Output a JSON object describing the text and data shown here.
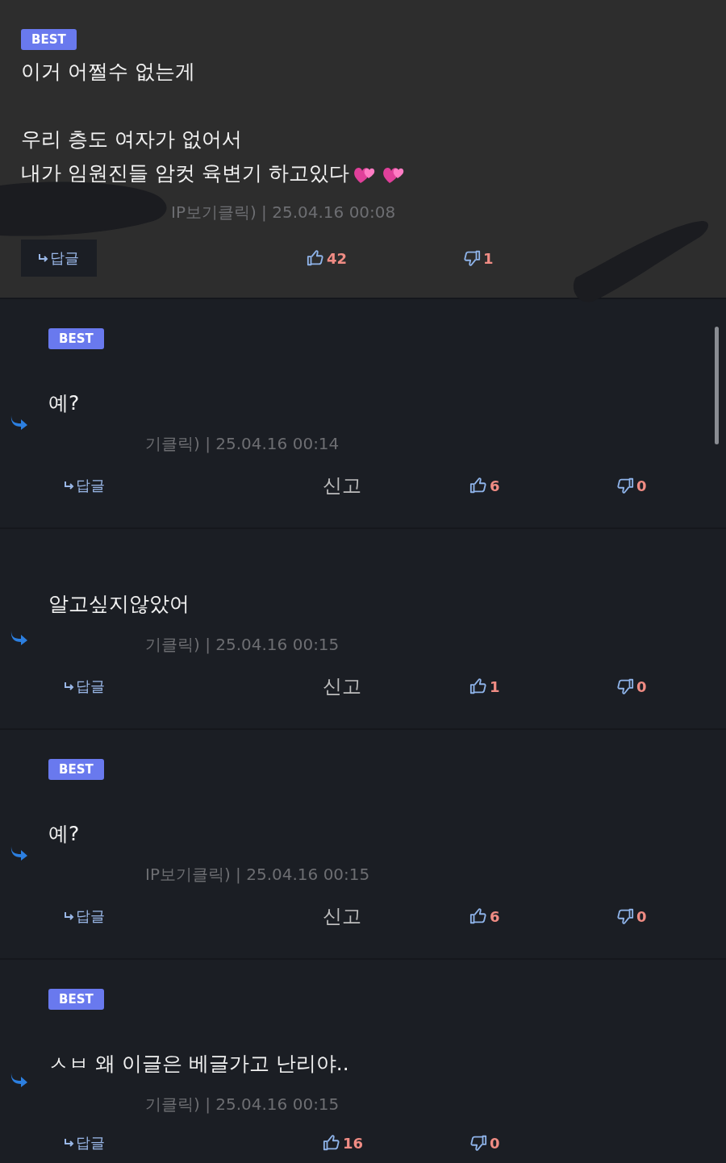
{
  "comments": [
    {
      "kind": "comment",
      "badge": "BEST",
      "paragraphs": [
        [
          "이거 어쩔수 없는게"
        ],
        [
          "우리 층도 여자가 없어서",
          "내가 임원진들 암컷 육변기 하고있다"
        ]
      ],
      "hearts": true,
      "meta": "IP보기클릭) | 25.04.16 00:08",
      "reply_label": "답글",
      "likes": "42",
      "dislikes": "1"
    },
    {
      "kind": "reply",
      "badge": "BEST",
      "paragraphs": [
        [
          "예?"
        ]
      ],
      "meta": "기클릭) | 25.04.16 00:14",
      "reply_label": "답글",
      "report": "신고",
      "likes": "6",
      "dislikes": "0"
    },
    {
      "kind": "reply",
      "paragraphs": [
        [
          "알고싶지않았어"
        ]
      ],
      "meta": "기클릭) | 25.04.16 00:15",
      "reply_label": "답글",
      "report": "신고",
      "likes": "1",
      "dislikes": "0"
    },
    {
      "kind": "reply",
      "badge": "BEST",
      "paragraphs": [
        [
          "예?"
        ]
      ],
      "meta": "IP보기클릭) | 25.04.16 00:15",
      "reply_label": "답글",
      "report": "신고",
      "likes": "6",
      "dislikes": "0"
    },
    {
      "kind": "reply",
      "badge": "BEST",
      "paragraphs": [
        [
          "ㅅㅂ 왜 이글은 베글가고 난리야.."
        ]
      ],
      "meta": "기클릭) | 25.04.16 00:15",
      "reply_label": "답글",
      "likes": "16",
      "dislikes": "0"
    }
  ]
}
